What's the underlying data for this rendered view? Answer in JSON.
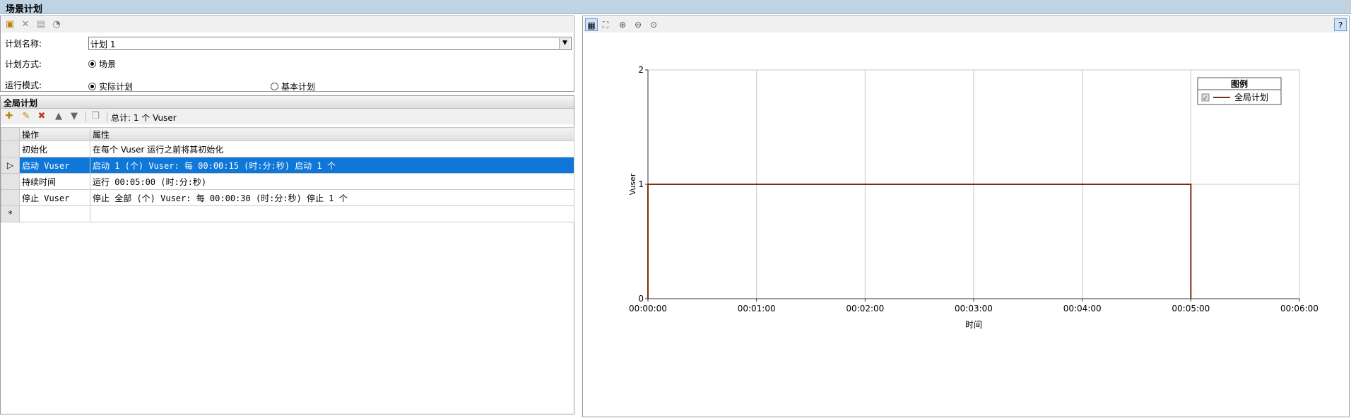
{
  "window": {
    "title": "场景计划"
  },
  "plan_form": {
    "name_label": "计划名称:",
    "name_value": "计划 1",
    "method_label": "计划方式:",
    "method_option": "场景",
    "mode_label": "运行模式:",
    "mode_options": [
      {
        "label": "实际计划",
        "selected": true
      },
      {
        "label": "基本计划",
        "selected": false
      }
    ]
  },
  "global_plan": {
    "title": "全局计划",
    "total_text": "总计: 1 个 Vuser",
    "columns": [
      "操作",
      "属性"
    ],
    "rows": [
      {
        "action": "初始化",
        "property": "在每个 Vuser 运行之前将其初始化"
      },
      {
        "action": "启动 Vuser",
        "property": "启动 1 (个) Vuser: 每 00:00:15 (时:分:秒) 启动 1 个",
        "selected": true
      },
      {
        "action": "持续时间",
        "property": "运行 00:05:00 (时:分:秒)"
      },
      {
        "action": "停止 Vuser",
        "property": "停止 全部 (个) Vuser: 每 00:00:30 (时:分:秒) 停止 1 个"
      }
    ],
    "new_row_marker": "*"
  },
  "chart_legend": {
    "title": "图例",
    "item": "全局计划",
    "checked": true
  },
  "icons": {
    "left_toolbar": [
      "new-plan-icon",
      "delete-icon",
      "rename-icon",
      "schedule-icon"
    ],
    "grid_toolbar": [
      "add-action-icon",
      "edit-action-icon",
      "delete-action-icon",
      "move-up-icon",
      "move-down-icon",
      "copy-icon"
    ],
    "chart_toolbar": [
      "graph-view-icon",
      "fit-view-icon",
      "zoom-in-icon",
      "zoom-out-icon",
      "zoom-reset-icon",
      "help-icon"
    ]
  },
  "colors": {
    "series": "#7a2f12",
    "selection": "#0f77d8",
    "titlebar": "#bfd3e3"
  },
  "chart_data": {
    "type": "line",
    "xlabel": "时间",
    "ylabel": "Vuser",
    "x_ticks": [
      "00:00:00",
      "00:01:00",
      "00:02:00",
      "00:03:00",
      "00:04:00",
      "00:05:00",
      "00:06:00"
    ],
    "y_ticks": [
      "0",
      "1",
      "2"
    ],
    "xlim": [
      0,
      360
    ],
    "ylim": [
      0,
      2
    ],
    "grid": true,
    "legend_position": "top-right",
    "series": [
      {
        "name": "全局计划",
        "x": [
          0,
          0,
          300,
          300
        ],
        "y": [
          0,
          1,
          1,
          0
        ]
      }
    ]
  }
}
